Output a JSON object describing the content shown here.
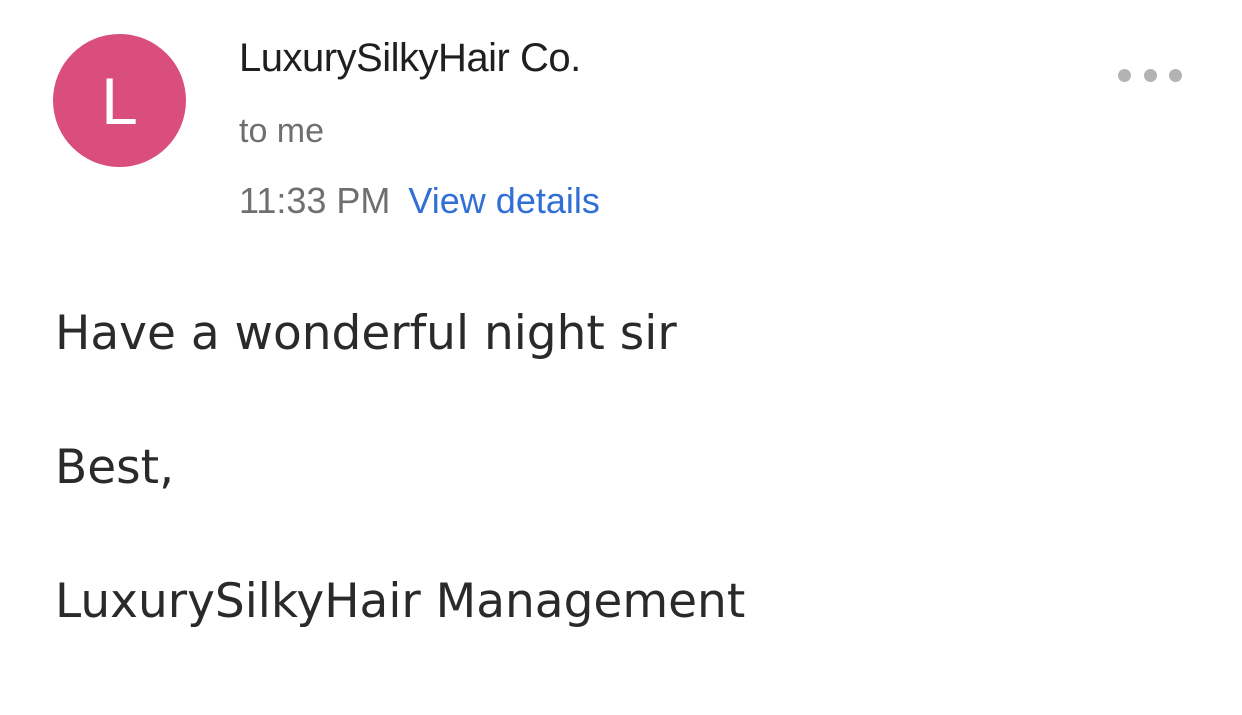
{
  "header": {
    "avatar_initial": "L",
    "avatar_color": "#d94e7c",
    "sender_name": "LuxurySilkyHair Co.",
    "recipient_text": "to me",
    "time": "11:33 PM",
    "view_details_label": "View details",
    "more_icon": "more-horizontal-icon"
  },
  "message": {
    "lines": [
      "Have a wonderful night sir",
      "Best,",
      "LuxurySilkyHair Management"
    ]
  },
  "colors": {
    "link": "#2f6fd6",
    "muted_text": "#6f6f6f"
  }
}
